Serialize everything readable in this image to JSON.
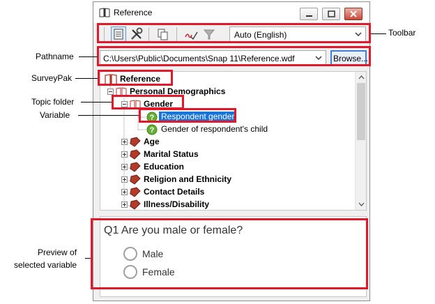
{
  "window": {
    "title": "Reference",
    "controls": {
      "minimize": "minimize",
      "maximize": "maximize",
      "close": "close"
    }
  },
  "toolbar": {
    "icons": [
      "reference-view-icon",
      "tools-icon",
      "copy-icon",
      "spell-check-icon",
      "filter-icon"
    ],
    "language_value": "Auto (English)"
  },
  "path": {
    "value": "C:\\Users\\Public\\Documents\\Snap 11\\Reference.wdf",
    "browse_label": "Browse..."
  },
  "tree": {
    "root": "Reference",
    "folder_open": "Personal Demographics",
    "topic": "Gender",
    "variables": [
      "Respondent gender",
      "Gender of respondent's child"
    ],
    "folders": [
      "Age",
      "Marital Status",
      "Education",
      "Religion and Ethnicity",
      "Contact Details",
      "Illness/Disability"
    ]
  },
  "preview": {
    "question": "Q1 Are you male or female?",
    "options": [
      "Male",
      "Female"
    ]
  },
  "annotations": {
    "toolbar": "Toolbar",
    "pathname": "Pathname",
    "surveypak": "SurveyPak",
    "topic_folder": "Topic folder",
    "variable": "Variable",
    "preview_line1": "Preview of",
    "preview_line2": "selected variable"
  },
  "colors": {
    "annotation": "#e01a2a",
    "selection": "#1874d6",
    "book": "#b23a2a"
  }
}
